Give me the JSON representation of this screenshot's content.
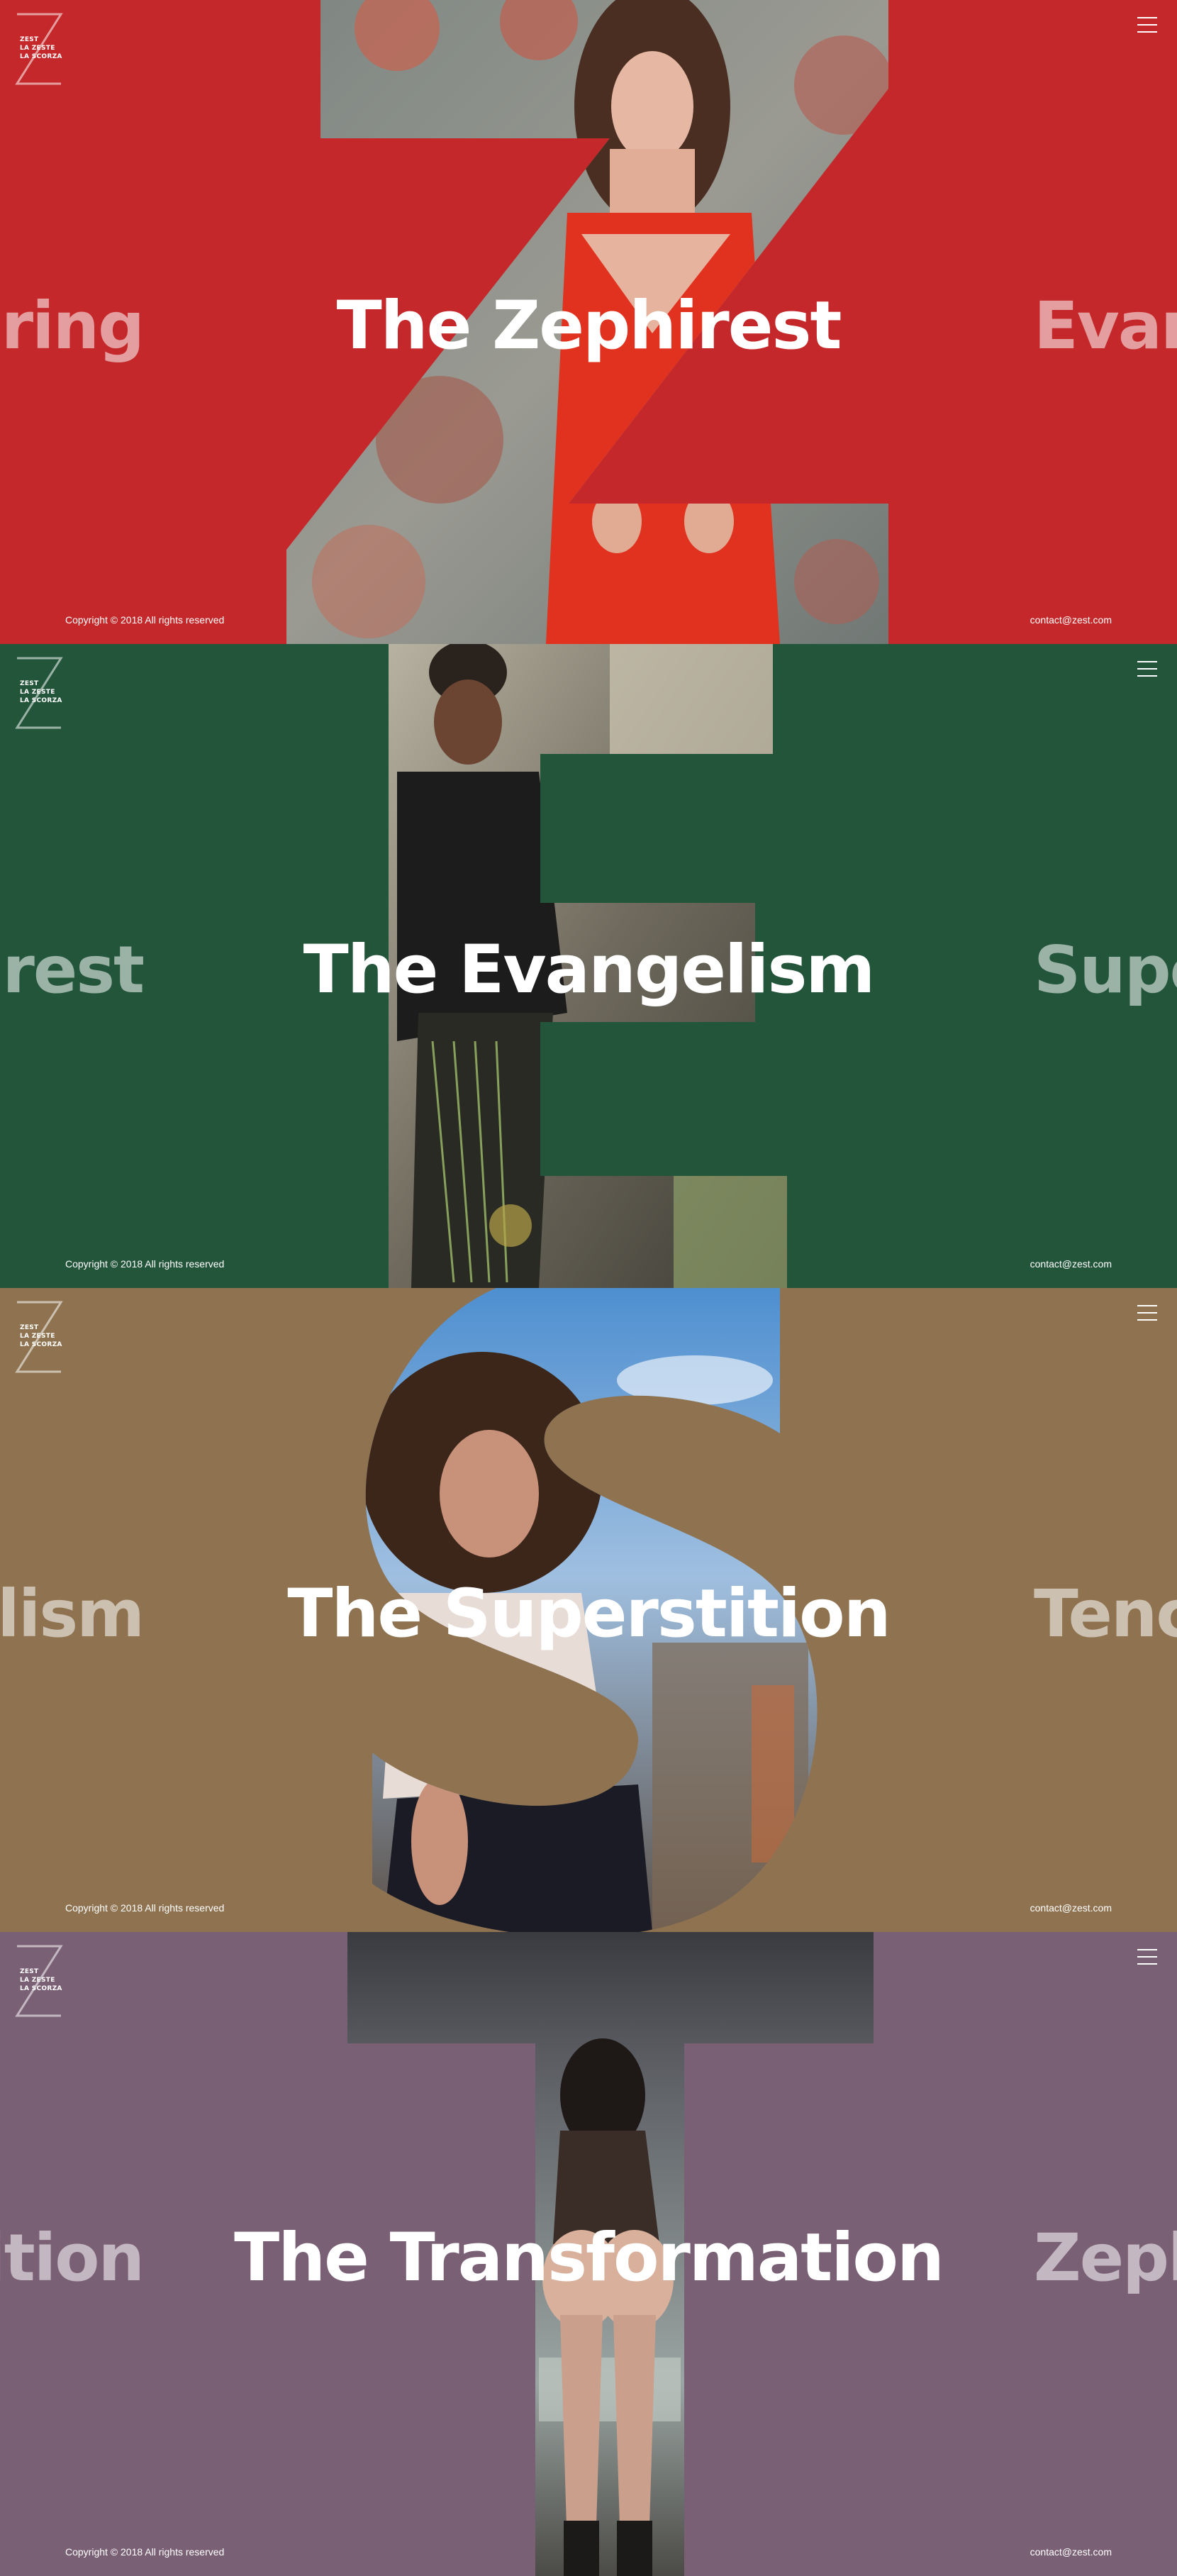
{
  "brand": {
    "logo_letter": "Z",
    "lines": [
      "ZEST",
      "LA ZESTE",
      "LA SCORZA"
    ]
  },
  "footer": {
    "copyright": "Copyright © 2018 All rights reserved",
    "contact": "contact@zest.com"
  },
  "slides": [
    {
      "title": "The Zephirest",
      "prev_word": "ering",
      "next_word": "Evan",
      "letter": "Z",
      "background": "#c4282a",
      "photo_colors": [
        "#8b8f8c",
        "#d9433a",
        "#c96b55"
      ]
    },
    {
      "title": "The Evangelism",
      "prev_word": "irest",
      "next_word": "Supe",
      "letter": "E",
      "background": "#23553b",
      "photo_colors": [
        "#8a8478",
        "#2a2a2a",
        "#c9c2a8"
      ]
    },
    {
      "title": "The Superstition",
      "prev_word": "elism",
      "next_word": "Tenc",
      "letter": "S",
      "background": "#8f7350",
      "photo_colors": [
        "#5b8fc4",
        "#6a4a35",
        "#d3c2b0"
      ]
    },
    {
      "title": "The Transformation",
      "prev_word": "ition",
      "next_word": "Zeph",
      "letter": "T",
      "background": "#7a6075",
      "photo_colors": [
        "#4c4d52",
        "#2b2a2d",
        "#a9b4b0"
      ]
    }
  ]
}
